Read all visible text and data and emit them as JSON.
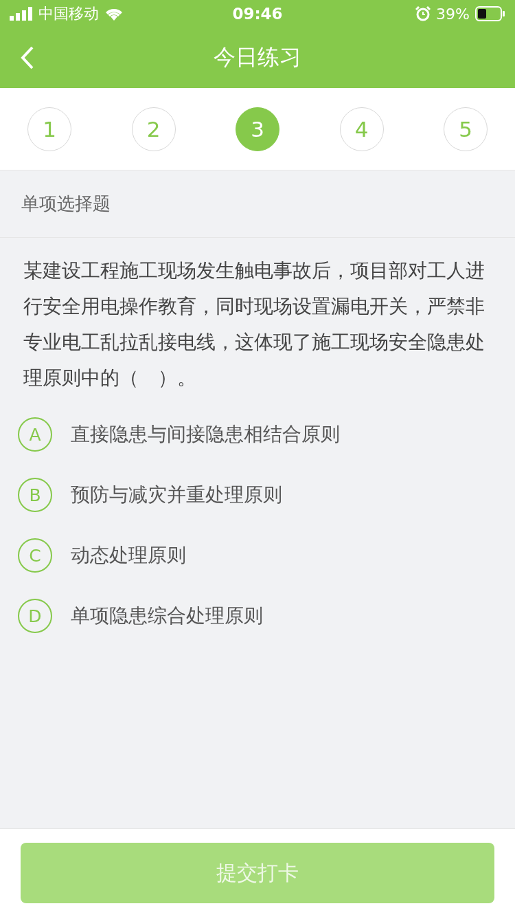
{
  "status_bar": {
    "carrier": "中国移动",
    "time": "09:46",
    "battery": "39%"
  },
  "nav": {
    "title": "今日练习"
  },
  "steps": [
    {
      "label": "1",
      "selected": false
    },
    {
      "label": "2",
      "selected": false
    },
    {
      "label": "3",
      "selected": true
    },
    {
      "label": "4",
      "selected": false
    },
    {
      "label": "5",
      "selected": false
    }
  ],
  "section_title": "单项选择题",
  "question": "某建设工程施工现场发生触电事故后，项目部对工人进行安全用电操作教育，同时现场设置漏电开关，严禁非专业电工乱拉乱接电线，这体现了施工现场安全隐患处理原则中的（　）。",
  "options": [
    {
      "letter": "A",
      "text": "直接隐患与间接隐患相结合原则"
    },
    {
      "letter": "B",
      "text": "预防与减灾并重处理原则"
    },
    {
      "letter": "C",
      "text": "动态处理原则"
    },
    {
      "letter": "D",
      "text": "单项隐患综合处理原则"
    }
  ],
  "submit": {
    "label": "提交打卡",
    "disabled": true
  }
}
